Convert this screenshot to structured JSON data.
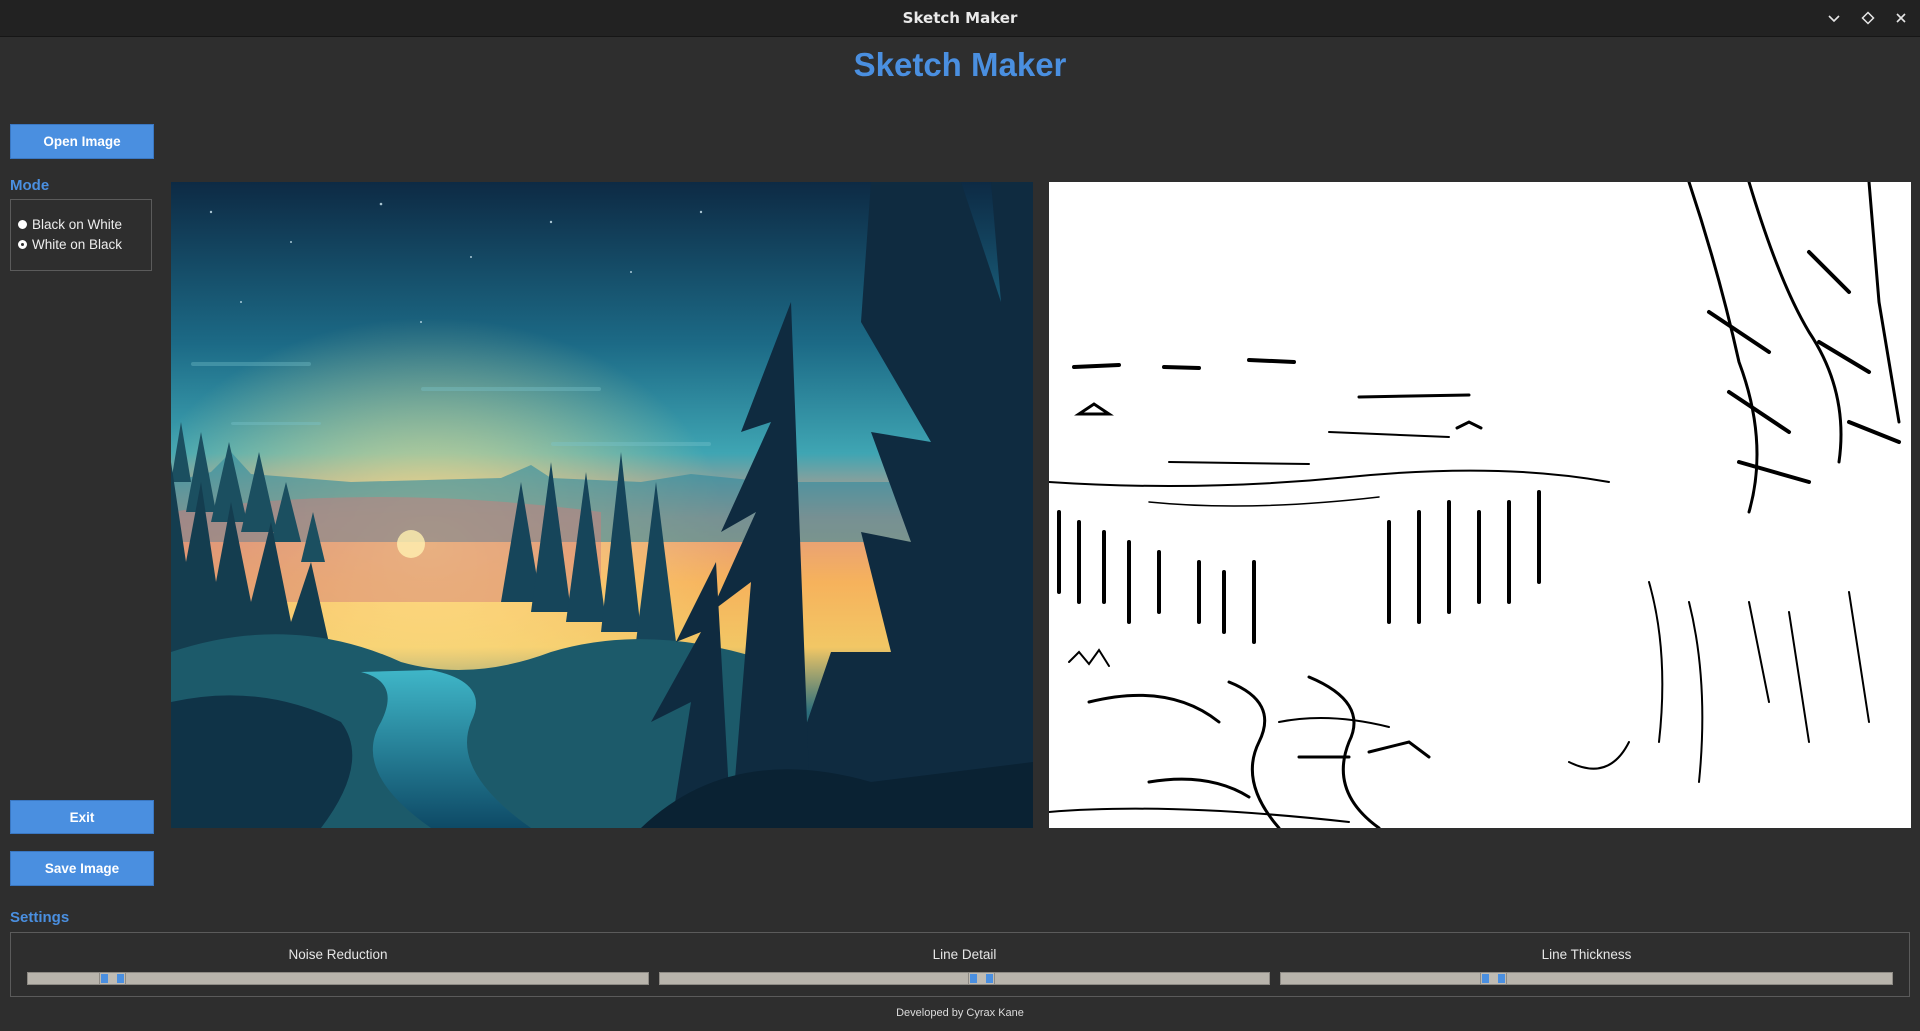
{
  "window": {
    "title": "Sketch Maker",
    "controls": [
      "minimize-icon",
      "maximize-icon",
      "close-icon"
    ]
  },
  "app": {
    "heading": "Sketch Maker",
    "accent_color": "#4a8fe0"
  },
  "buttons": {
    "open_image": "Open Image",
    "exit": "Exit",
    "save_image": "Save Image"
  },
  "mode": {
    "label": "Mode",
    "options": [
      {
        "label": "Black on White",
        "selected": false
      },
      {
        "label": "White on Black",
        "selected": true
      }
    ]
  },
  "images": {
    "original": "forest-sunset-landscape",
    "sketch": "sketch-output"
  },
  "settings": {
    "label": "Settings",
    "sliders": [
      {
        "label": "Noise Reduction",
        "value_fraction": 0.12
      },
      {
        "label": "Line Detail",
        "value_fraction": 0.53
      },
      {
        "label": "Line Thickness",
        "value_fraction": 0.34
      }
    ]
  },
  "footer": {
    "credit": "Developed by Cyrax Kane"
  }
}
